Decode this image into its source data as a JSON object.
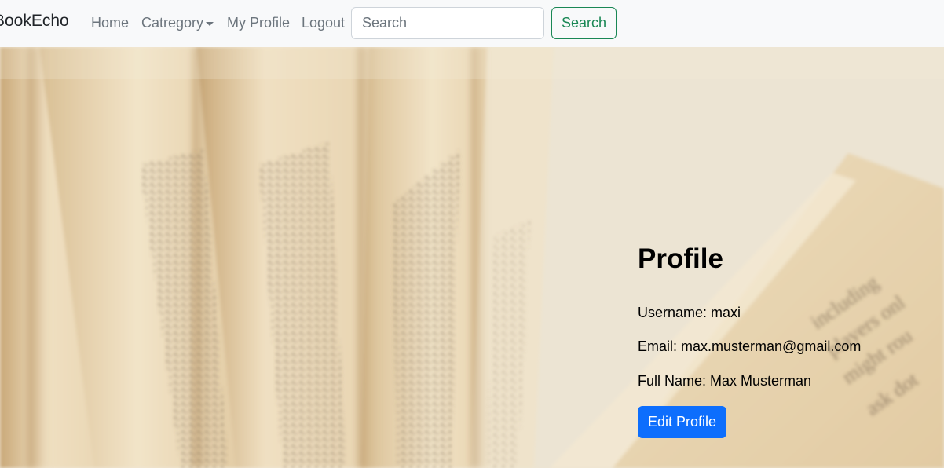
{
  "navbar": {
    "brand": "BookEcho",
    "links": {
      "home": "Home",
      "category": "Catregory",
      "my_profile": "My Profile",
      "logout": "Logout"
    },
    "search": {
      "placeholder": "Search",
      "button_label": "Search"
    }
  },
  "profile": {
    "title": "Profile",
    "username": "Username: maxi",
    "email": "Email: max.musterman@gmail.com",
    "full_name": "Full Name: Max Musterman",
    "edit_button": "Edit Profile"
  },
  "colors": {
    "navbar_bg": "#f8f9fa",
    "search_outline": "#198754",
    "primary_button": "#0d6efd"
  },
  "icons": {
    "category_dropdown": "caret-down-icon"
  }
}
